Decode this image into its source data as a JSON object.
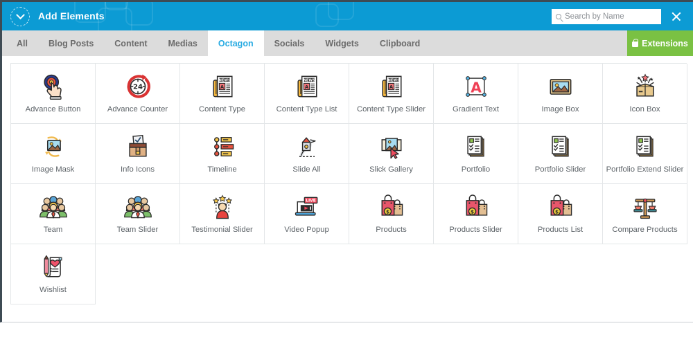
{
  "header": {
    "title": "Add Elements",
    "collapse_icon": "chevron-down-icon",
    "search": {
      "placeholder": "Search by Name",
      "value": "",
      "icon": "search-icon"
    },
    "close_icon": "close-icon",
    "background_color": "#0c9bd4"
  },
  "tabs": [
    {
      "label": "All",
      "active": false
    },
    {
      "label": "Blog Posts",
      "active": false
    },
    {
      "label": "Content",
      "active": false
    },
    {
      "label": "Medias",
      "active": false
    },
    {
      "label": "Octagon",
      "active": true
    },
    {
      "label": "Socials",
      "active": false
    },
    {
      "label": "Widgets",
      "active": false
    },
    {
      "label": "Clipboard",
      "active": false
    }
  ],
  "extensions_button": {
    "label": "Extensions",
    "icon": "lock-icon",
    "color": "#7ac143"
  },
  "colors": {
    "accent": "#0c9bd4",
    "active_tab_text": "#29abe2",
    "tabbar_background": "#dcdcdc",
    "grid_border": "#e3e6e8",
    "caption_text": "#5d6368"
  },
  "elements": [
    {
      "label": "Advance Button",
      "icon": "advance-button-icon"
    },
    {
      "label": "Advance Counter",
      "icon": "advance-counter-icon"
    },
    {
      "label": "Content Type",
      "icon": "newspaper-icon"
    },
    {
      "label": "Content Type List",
      "icon": "newspaper-icon"
    },
    {
      "label": "Content Type Slider",
      "icon": "newspaper-icon"
    },
    {
      "label": "Gradient Text",
      "icon": "gradient-text-icon"
    },
    {
      "label": "Image Box",
      "icon": "image-box-icon"
    },
    {
      "label": "Icon Box",
      "icon": "icon-box-icon"
    },
    {
      "label": "Image Mask",
      "icon": "image-mask-icon"
    },
    {
      "label": "Info Icons",
      "icon": "info-icons-icon"
    },
    {
      "label": "Timeline",
      "icon": "timeline-icon"
    },
    {
      "label": "Slide All",
      "icon": "slide-all-icon"
    },
    {
      "label": "Slick Gallery",
      "icon": "slick-gallery-icon"
    },
    {
      "label": "Portfolio",
      "icon": "portfolio-icon"
    },
    {
      "label": "Portfolio Slider",
      "icon": "portfolio-icon"
    },
    {
      "label": "Portfolio Extend Slider",
      "icon": "portfolio-icon"
    },
    {
      "label": "Team",
      "icon": "team-icon"
    },
    {
      "label": "Team Slider",
      "icon": "team-icon"
    },
    {
      "label": "Testimonial Slider",
      "icon": "testimonial-icon"
    },
    {
      "label": "Video Popup",
      "icon": "video-popup-icon"
    },
    {
      "label": "Products",
      "icon": "products-icon"
    },
    {
      "label": "Products Slider",
      "icon": "products-icon"
    },
    {
      "label": "Products List",
      "icon": "products-icon"
    },
    {
      "label": "Compare Products",
      "icon": "compare-products-icon"
    },
    {
      "label": "Wishlist",
      "icon": "wishlist-icon"
    }
  ]
}
